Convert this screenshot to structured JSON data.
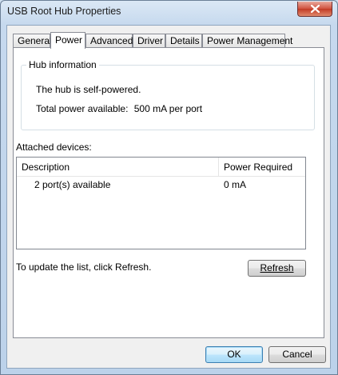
{
  "window": {
    "title": "USB Root Hub Properties"
  },
  "tabs": [
    {
      "label": "General",
      "active": false
    },
    {
      "label": "Power",
      "active": true
    },
    {
      "label": "Advanced",
      "active": false
    },
    {
      "label": "Driver",
      "active": false
    },
    {
      "label": "Details",
      "active": false
    },
    {
      "label": "Power Management",
      "active": false
    }
  ],
  "hub_info": {
    "group_title": "Hub information",
    "status": "The hub is self-powered.",
    "power_label": "Total power available:",
    "power_value": "500 mA per port"
  },
  "attached": {
    "label": "Attached devices:",
    "columns": [
      "Description",
      "Power Required"
    ],
    "rows": [
      [
        "2 port(s) available",
        "0 mA"
      ]
    ]
  },
  "refresh": {
    "hint": "To update the list, click Refresh.",
    "button_label": "Refresh"
  },
  "footer": {
    "ok_label": "OK",
    "cancel_label": "Cancel"
  },
  "colors": {
    "title_bar": "#c6d9ee",
    "close_button": "#c13a24",
    "default_button_border": "#3c7fb1"
  }
}
